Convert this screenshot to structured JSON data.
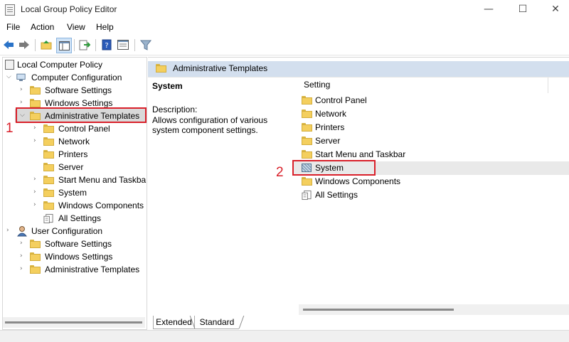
{
  "window": {
    "title": "Local Group Policy Editor",
    "controls": {
      "minimize": "—",
      "maximize": "☐",
      "close": "✕"
    }
  },
  "menu": [
    "File",
    "Action",
    "View",
    "Help"
  ],
  "toolbar": {
    "icons": [
      "back-arrow-icon",
      "forward-arrow-icon",
      "up-folder-icon",
      "show-hide-tree-icon",
      "export-list-icon",
      "help-icon",
      "properties-icon",
      "filter-icon"
    ]
  },
  "tree": {
    "root": "Local Computer Policy",
    "computer_configuration": "Computer Configuration",
    "cc_software_settings": "Software Settings",
    "cc_windows_settings": "Windows Settings",
    "cc_admin_templates": "Administrative Templates",
    "at_children": [
      "Control Panel",
      "Network",
      "Printers",
      "Server",
      "Start Menu and Taskbar",
      "System",
      "Windows Components",
      "All Settings"
    ],
    "user_configuration": "User Configuration",
    "uc_software_settings": "Software Settings",
    "uc_windows_settings": "Windows Settings",
    "uc_admin_templates": "Administrative Templates"
  },
  "right_pane": {
    "header": "Administrative Templates",
    "selected_title": "System",
    "description_label": "Description:",
    "description_text": "Allows configuration of various system component settings.",
    "column_header": "Setting",
    "items": [
      "Control Panel",
      "Network",
      "Printers",
      "Server",
      "Start Menu and Taskbar",
      "System",
      "Windows Components",
      "All Settings"
    ]
  },
  "annotations": {
    "step1": "1",
    "step2": "2"
  },
  "tabs": {
    "extended": "Extended",
    "standard": "Standard"
  },
  "colors": {
    "annotation_red": "#d9202a",
    "header_blue": "#d3dfee",
    "folder_yellow": "#f4cf5e"
  }
}
